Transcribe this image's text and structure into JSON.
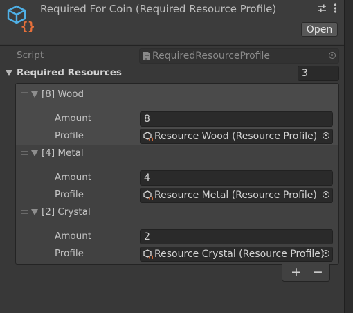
{
  "header": {
    "title": "Required For Coin (Required Resource Profile)",
    "open_label": "Open"
  },
  "script_row": {
    "label": "Script",
    "value": "RequiredResourceProfile"
  },
  "list": {
    "label": "Required Resources",
    "size": "3",
    "items": [
      {
        "header": "[8] Wood",
        "amount_label": "Amount",
        "amount": "8",
        "profile_label": "Profile",
        "profile": "Resource Wood (Resource Profile)"
      },
      {
        "header": "[4] Metal",
        "amount_label": "Amount",
        "amount": "4",
        "profile_label": "Profile",
        "profile": "Resource Metal (Resource Profile)"
      },
      {
        "header": "[2] Crystal",
        "amount_label": "Amount",
        "amount": "2",
        "profile_label": "Profile",
        "profile": "Resource Crystal (Resource Profile)"
      }
    ]
  },
  "footer": {
    "add_label": "+",
    "remove_label": "−"
  },
  "colors": {
    "accent_blue": "#4fb0e6",
    "accent_orange": "#e8703a",
    "panel_bg": "#383838"
  }
}
